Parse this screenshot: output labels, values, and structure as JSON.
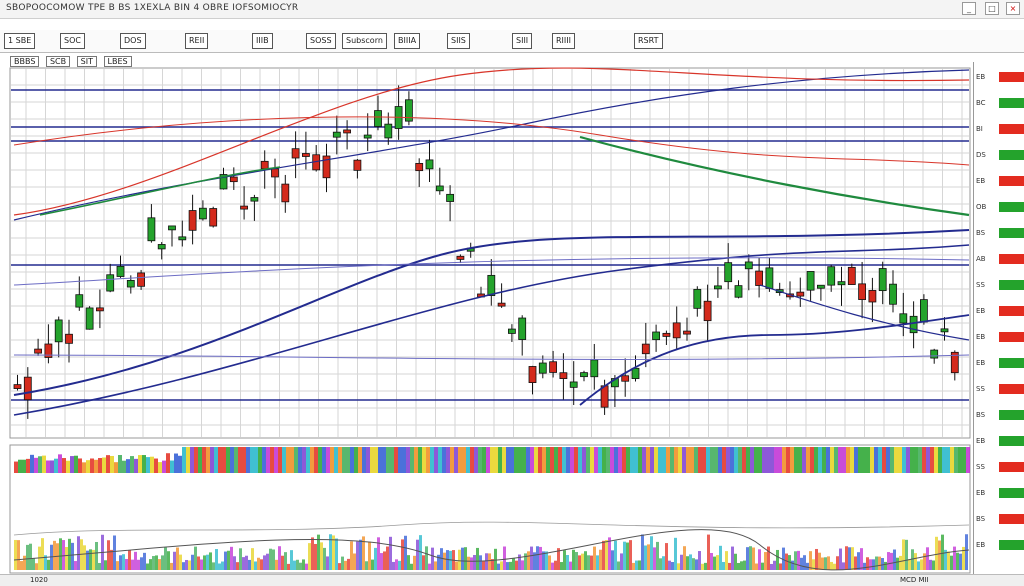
{
  "app": {
    "title": "SBOPOOCOMOW TPE B BS 1XEXLA BIN 4 OBRE IOFSOMIOCYR",
    "window_buttons": [
      "_",
      "□",
      "×"
    ]
  },
  "toolbar": {
    "buttons": [
      "1 SBE",
      "SOC",
      "DOS",
      "REII",
      "IIIB",
      "BIIIA",
      "SIIS",
      "SIII",
      "RSRT"
    ],
    "text_items": [
      "SOSS",
      "Subscorn",
      "RIIII"
    ]
  },
  "chart_panel": {
    "labels": [
      "BBBS",
      "SCB",
      "SIT",
      "LBES"
    ]
  },
  "status": {
    "left": "1020",
    "right": "MCD MII"
  },
  "watchlist": {
    "colors": [
      "#e32b1f",
      "#24a32c",
      "#e32b1f",
      "#24a32c",
      "#e32b1f",
      "#24a32c",
      "#24a32c",
      "#e32b1f",
      "#24a32c",
      "#e32b1f",
      "#e32b1f",
      "#24a32c",
      "#e32b1f",
      "#24a32c",
      "#24a32c",
      "#e32b1f",
      "#24a32c",
      "#e32b1f",
      "#24a32c"
    ],
    "labels": [
      "EB",
      "BC",
      "BI",
      "DS",
      "EB",
      "OB",
      "BS",
      "AB",
      "SS",
      "EB",
      "EB",
      "EB",
      "SS",
      "BS",
      "EB",
      "SS",
      "EB",
      "BS",
      "EB"
    ]
  },
  "colors": {
    "up": "#24a32c",
    "down": "#d42a1c",
    "navy": "#232b8f",
    "red_line": "#d8352a",
    "green_line": "#1f8a3e",
    "grid": "#d6d6d6"
  }
}
